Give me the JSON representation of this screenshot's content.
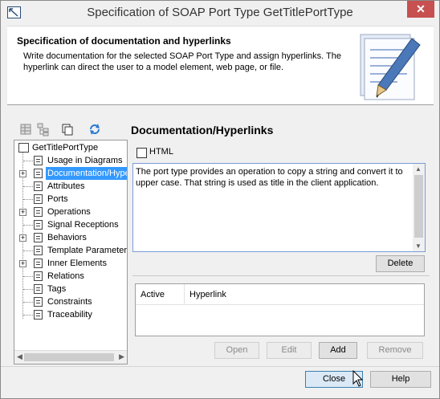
{
  "window": {
    "title": "Specification of SOAP Port Type GetTitlePortType",
    "close_glyph": "✕"
  },
  "header": {
    "title": "Specification of documentation and hyperlinks",
    "description": "Write documentation for the selected SOAP Port Type and assign hyperlinks. The hyperlink can direct the user to a model element, web page, or file."
  },
  "tree": {
    "root": "GetTitlePortType",
    "items": [
      {
        "label": "Usage in Diagrams",
        "expandable": false,
        "selected": false
      },
      {
        "label": "Documentation/Hyperlinks",
        "expandable": true,
        "selected": true
      },
      {
        "label": "Attributes",
        "expandable": false,
        "selected": false
      },
      {
        "label": "Ports",
        "expandable": false,
        "selected": false
      },
      {
        "label": "Operations",
        "expandable": true,
        "selected": false
      },
      {
        "label": "Signal Receptions",
        "expandable": false,
        "selected": false
      },
      {
        "label": "Behaviors",
        "expandable": true,
        "selected": false
      },
      {
        "label": "Template Parameters",
        "expandable": false,
        "selected": false
      },
      {
        "label": "Inner Elements",
        "expandable": true,
        "selected": false
      },
      {
        "label": "Relations",
        "expandable": false,
        "selected": false
      },
      {
        "label": "Tags",
        "expandable": false,
        "selected": false
      },
      {
        "label": "Constraints",
        "expandable": false,
        "selected": false
      },
      {
        "label": "Traceability",
        "expandable": false,
        "selected": false
      }
    ]
  },
  "panel": {
    "title": "Documentation/Hyperlinks",
    "html_checkbox_label": "HTML",
    "html_checked": false,
    "documentation": "The port type provides an operation to copy a string and convert it to upper case. That string is used as title in the client application.",
    "delete_label": "Delete",
    "table_headers": [
      "Active",
      "Hyperlink"
    ],
    "open_label": "Open",
    "edit_label": "Edit",
    "add_label": "Add",
    "remove_label": "Remove"
  },
  "footer": {
    "close_label": "Close",
    "help_label": "Help"
  },
  "icons": {
    "toolbar": [
      "table-view-icon",
      "tree-view-icon",
      "copy-icon",
      "refresh-icon"
    ],
    "accent_blue": "#3399ff",
    "close_red": "#c75050"
  }
}
